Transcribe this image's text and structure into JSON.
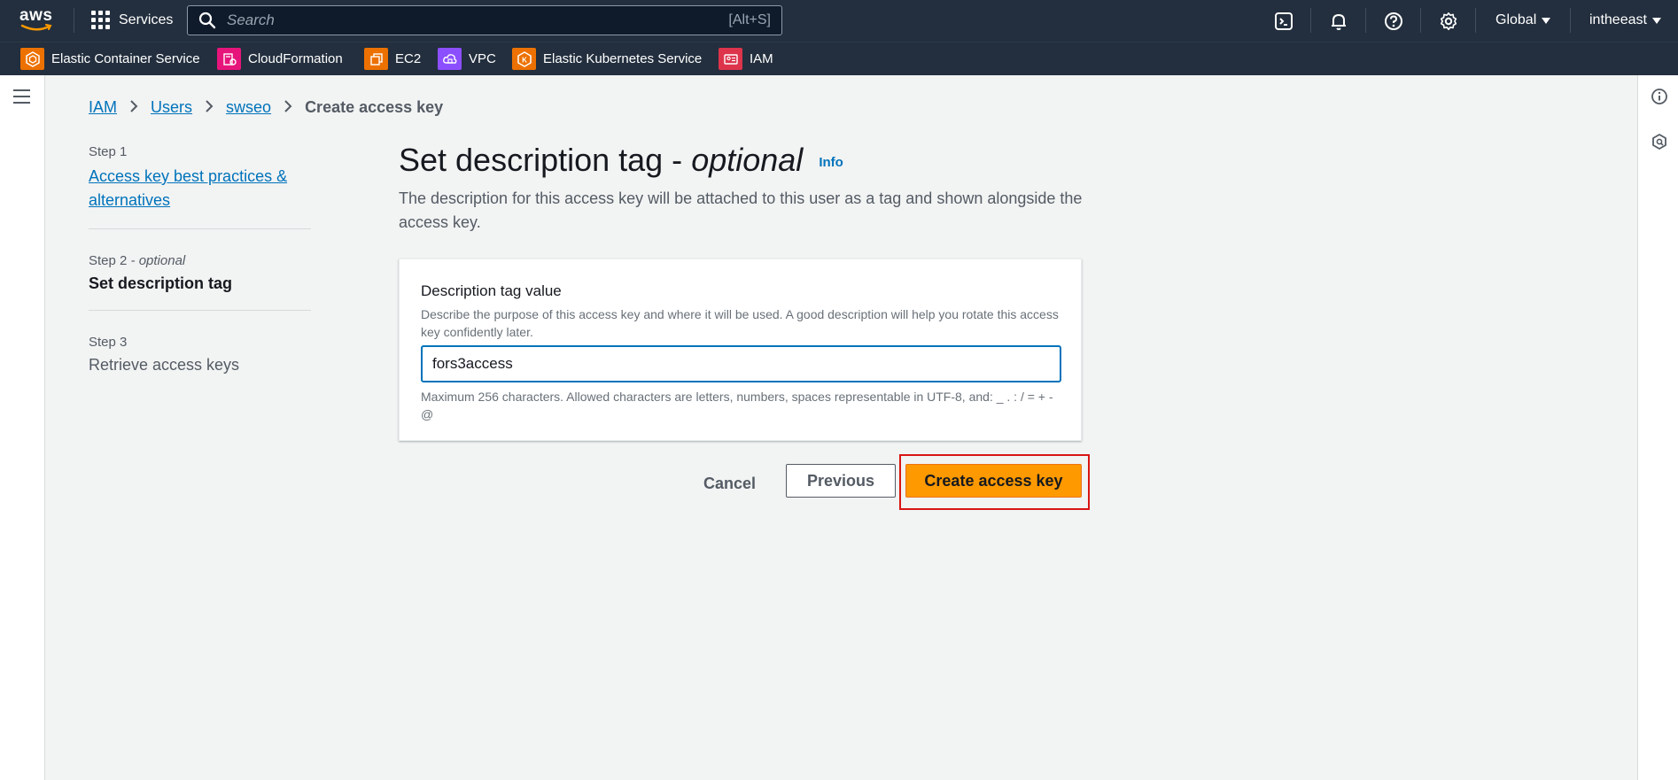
{
  "topnav": {
    "logo_text": "aws",
    "services_label": "Services",
    "search_placeholder": "Search",
    "search_shortcut": "[Alt+S]",
    "region_label": "Global",
    "account_label": "intheeast"
  },
  "favorites": [
    {
      "label": "Elastic Container Service",
      "color": "#ed7100"
    },
    {
      "label": "CloudFormation",
      "color": "#e7157b"
    },
    {
      "label": "EC2",
      "color": "#ed7100"
    },
    {
      "label": "VPC",
      "color": "#8c4fff"
    },
    {
      "label": "Elastic Kubernetes Service",
      "color": "#ed7100"
    },
    {
      "label": "IAM",
      "color": "#dd344c"
    }
  ],
  "breadcrumb": {
    "items": [
      "IAM",
      "Users",
      "swseo"
    ],
    "current": "Create access key"
  },
  "steps": {
    "step1_label": "Step 1",
    "step1_title": "Access key best practices & alternatives",
    "step2_label": "Step 2",
    "step2_optional": "- optional",
    "step2_title": "Set description tag",
    "step3_label": "Step 3",
    "step3_title": "Retrieve access keys"
  },
  "main": {
    "title": "Set description tag -",
    "title_optional": "optional",
    "info_link": "Info",
    "subtitle": "The description for this access key will be attached to this user as a tag and shown alongside the access key.",
    "field_label": "Description tag value",
    "field_description": "Describe the purpose of this access key and where it will be used. A good description will help you rotate this access key confidently later.",
    "field_value": "fors3access",
    "field_constraint": "Maximum 256 characters. Allowed characters are letters, numbers, spaces representable in UTF-8, and: _ . : / = + - @"
  },
  "actions": {
    "cancel": "Cancel",
    "previous": "Previous",
    "create": "Create access key"
  },
  "colors": {
    "nav_bg": "#232f3e",
    "link": "#0073bb",
    "primary_button": "#ff9900",
    "highlight_box": "#d91515"
  }
}
